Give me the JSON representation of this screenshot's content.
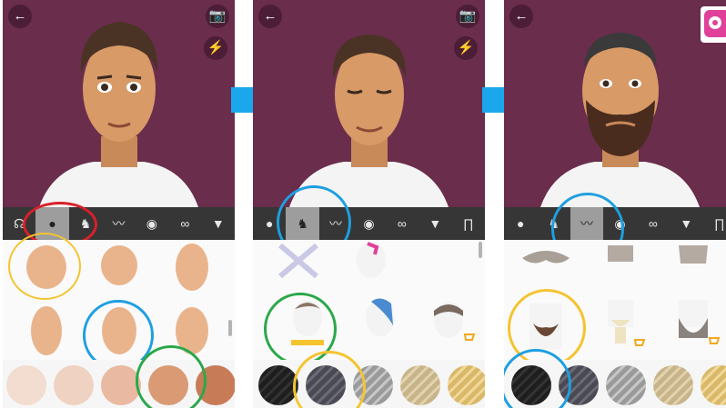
{
  "screens": [
    {
      "name": "face-shape-editor",
      "selected_tool": "face-shape"
    },
    {
      "name": "hair-editor",
      "selected_tool": "hair"
    },
    {
      "name": "facial-hair-editor",
      "selected_tool": "facial-hair"
    }
  ],
  "toolbar_icons": [
    "face-shape-icon",
    "hair-icon",
    "mustache-icon",
    "eye-icon",
    "glasses-icon",
    "tshirt-icon",
    "pants-icon"
  ],
  "top_buttons": {
    "back": "←",
    "camera": "📷",
    "flash": "⚡"
  },
  "colors": {
    "stage_background": "#6a2d4c",
    "toolbar_background": "#363636",
    "toolbar_selected": "#9d9d9d",
    "highlight_red": "#d8202a",
    "highlight_blue": "#1e9fe0",
    "highlight_green": "#2aa84a",
    "highlight_yellow": "#f4c430",
    "arrow_blue": "#1aa7ec",
    "cart_icon": "#f0a81e"
  },
  "skin_tones": [
    "#f2ddd0",
    "#f0d2c2",
    "#e9b9a1",
    "#d99a74",
    "#c87b57"
  ],
  "hair_colors": [
    "#1e1e1e",
    "#4a4a55",
    "#9a9a9a",
    "#c8b48a",
    "#d9b86a"
  ],
  "facial_hair_colors": [
    "#1e1e1e",
    "#4a4a55",
    "#9a9a9a",
    "#c8b48a",
    "#d9b86a"
  ]
}
